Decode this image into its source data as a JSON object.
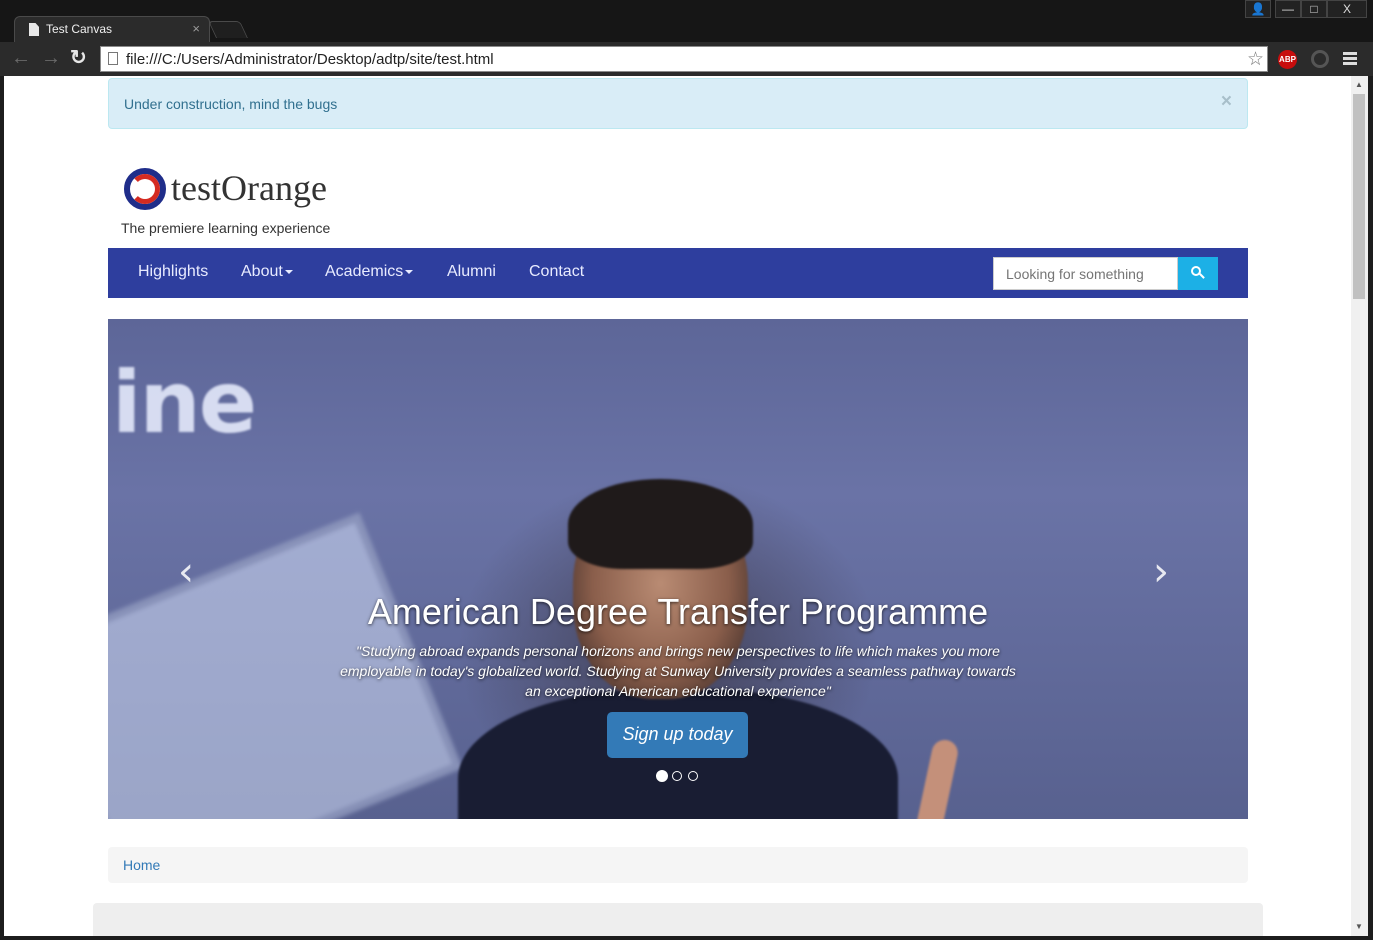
{
  "browser": {
    "tab_title": "Test Canvas",
    "tab_close": "×",
    "url": "file:///C:/Users/Administrator/Desktop/adtp/site/test.html",
    "extension_abp": "ABP",
    "window_controls": {
      "user": "👤",
      "minimize": "—",
      "maximize": "□",
      "close": "X"
    }
  },
  "alert": {
    "message": "Under construction, mind the bugs",
    "close": "×"
  },
  "brand": {
    "name": "testOrange",
    "tagline": "The premiere learning experience"
  },
  "nav": {
    "items": [
      {
        "label": "Highlights"
      },
      {
        "label": "About"
      },
      {
        "label": "Academics"
      },
      {
        "label": "Alumni"
      },
      {
        "label": "Contact"
      }
    ],
    "search_placeholder": "Looking for something"
  },
  "carousel": {
    "background_text": "ine",
    "title": "American Degree Transfer Programme",
    "quote": "\"Studying abroad expands personal horizons and brings new perspectives to life which makes you more employable in today's globalized world. Studying at Sunway University provides a seamless pathway towards an exceptional American educational experience\"",
    "button": "Sign up today",
    "prev": "‹",
    "next": "›",
    "slide_count": 3,
    "active_slide": 1
  },
  "breadcrumb": {
    "home": "Home"
  },
  "colors": {
    "navbar": "#2e3e9e",
    "search_button": "#1cb0e6",
    "cta": "#337ab7",
    "alert_bg": "#d9edf7"
  }
}
